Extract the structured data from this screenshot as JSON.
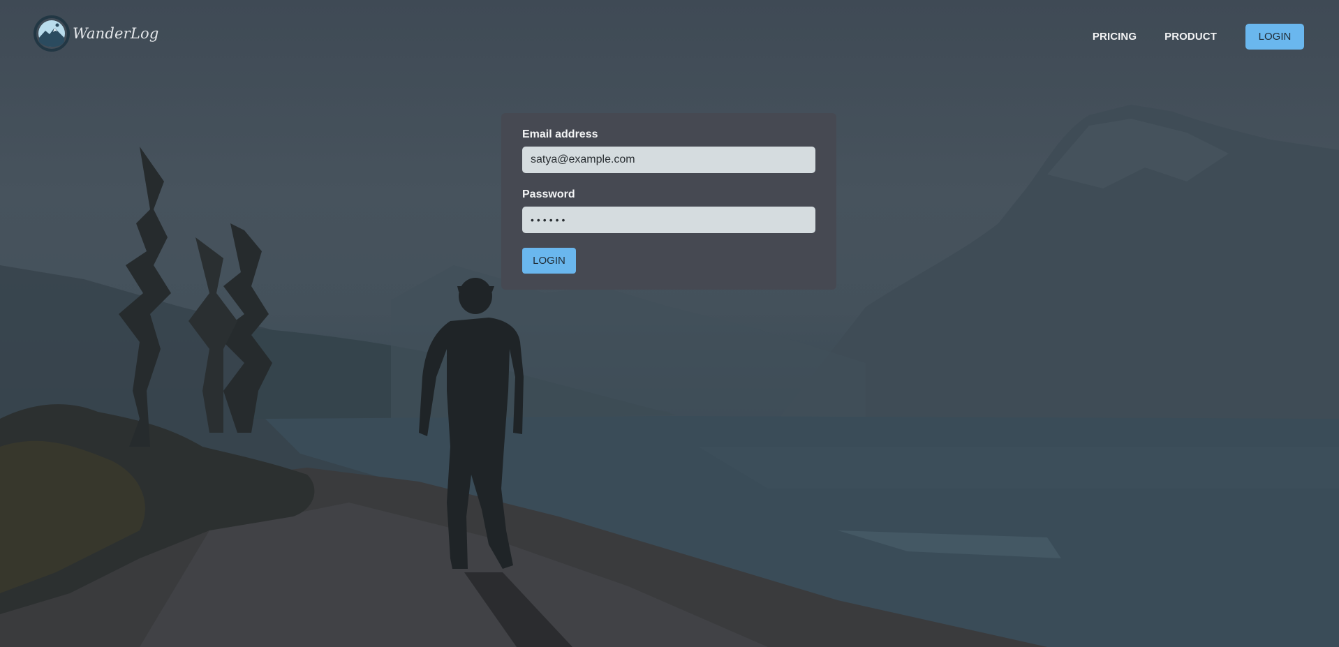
{
  "brand": {
    "name": "WanderLog",
    "logo_icon": "mountain-logo-icon"
  },
  "nav": {
    "pricing": "PRICING",
    "product": "PRODUCT",
    "login": "LOGIN"
  },
  "login_form": {
    "email_label": "Email address",
    "email_value": "satya@example.com",
    "password_label": "Password",
    "password_display": "••••••",
    "submit_label": "LOGIN"
  },
  "colors": {
    "accent": "#6ab7ee",
    "card_bg": "#464951",
    "input_bg": "#d5dcdf"
  },
  "background": {
    "scene": "hiker-walking-by-mountain-lake-photo"
  }
}
